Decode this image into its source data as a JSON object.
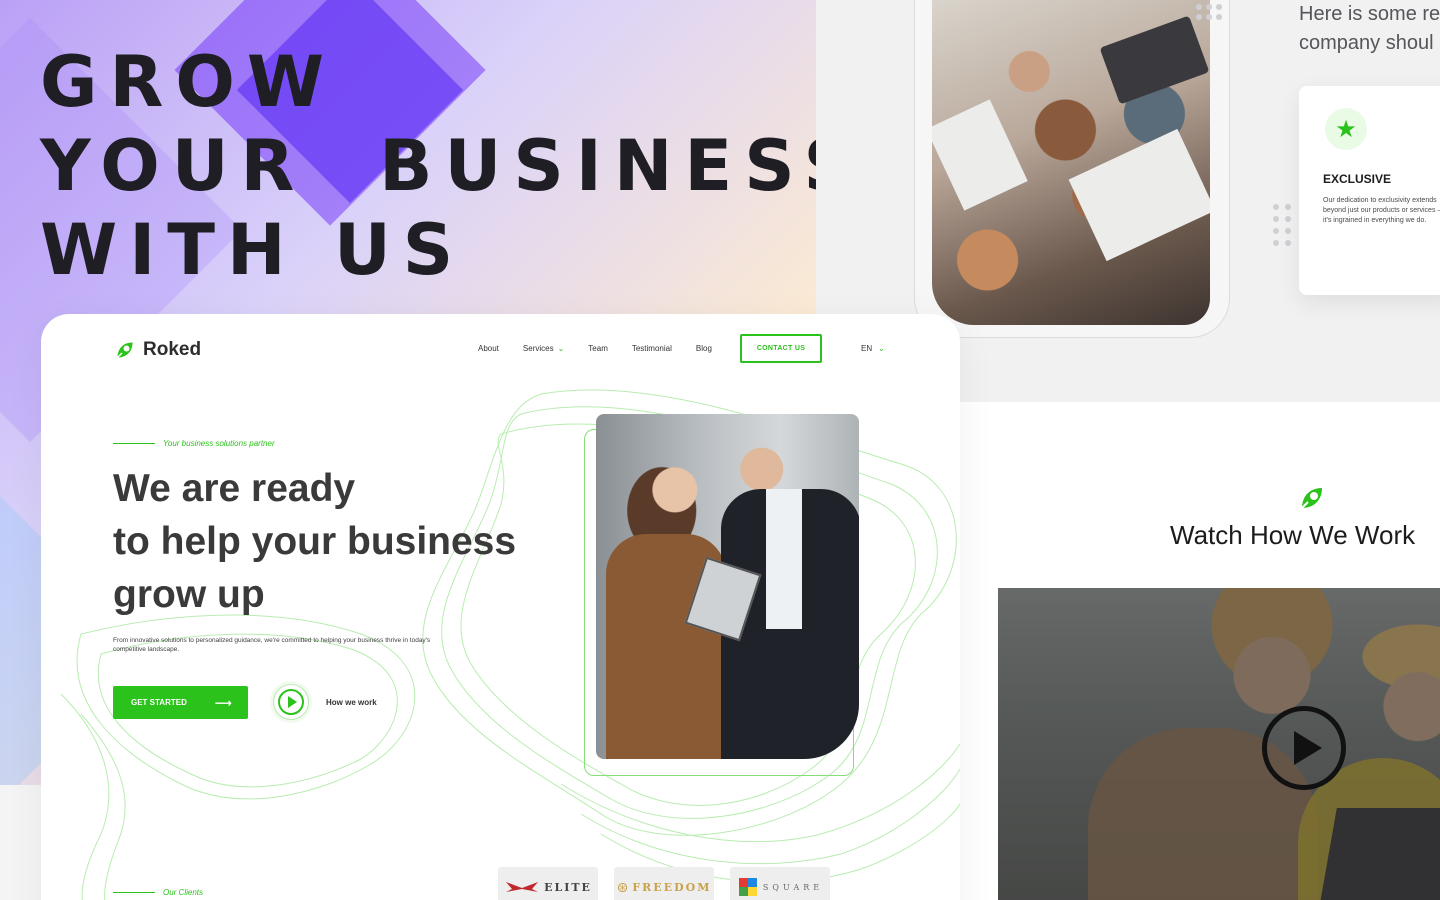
{
  "hero": {
    "headline_lines": [
      "GROW",
      "YOUR  BUSINESS",
      "WITH US"
    ]
  },
  "feature_panel": {
    "intro_line1": "Here is some re",
    "intro_line2": "company shoul",
    "card": {
      "icon": "star-icon",
      "title": "EXCLUSIVE",
      "description": "Our dedication to exclusivity extends beyond just our products or services – it's ingrained in everything we do."
    }
  },
  "watch": {
    "title": "Watch How We Work",
    "play_icon": "play-icon"
  },
  "mockup": {
    "logo_text": "Roked",
    "nav": {
      "about": "About",
      "services": "Services",
      "team": "Team",
      "testimonial": "Testimonial",
      "blog": "Blog"
    },
    "contact_button": "CONTACT US",
    "language": "EN",
    "tagline": "Your business solutions partner",
    "heading_lines": [
      "We are ready",
      "to help your business",
      "grow up"
    ],
    "description": "From innovative solutions to personalized guidance, we're committed to helping your business thrive in today's competitive landscape.",
    "get_started": "GET STARTED",
    "how_we_work": "How we work",
    "clients_label": "Our Clients",
    "clients": [
      "ELITE",
      "FREEDOM",
      "SQUARE"
    ]
  },
  "colors": {
    "accent_green": "#2bc21b",
    "headline_dark": "#1e1e24",
    "hero_purple": "#8b5cf6",
    "hero_orange": "#ffcd78"
  }
}
